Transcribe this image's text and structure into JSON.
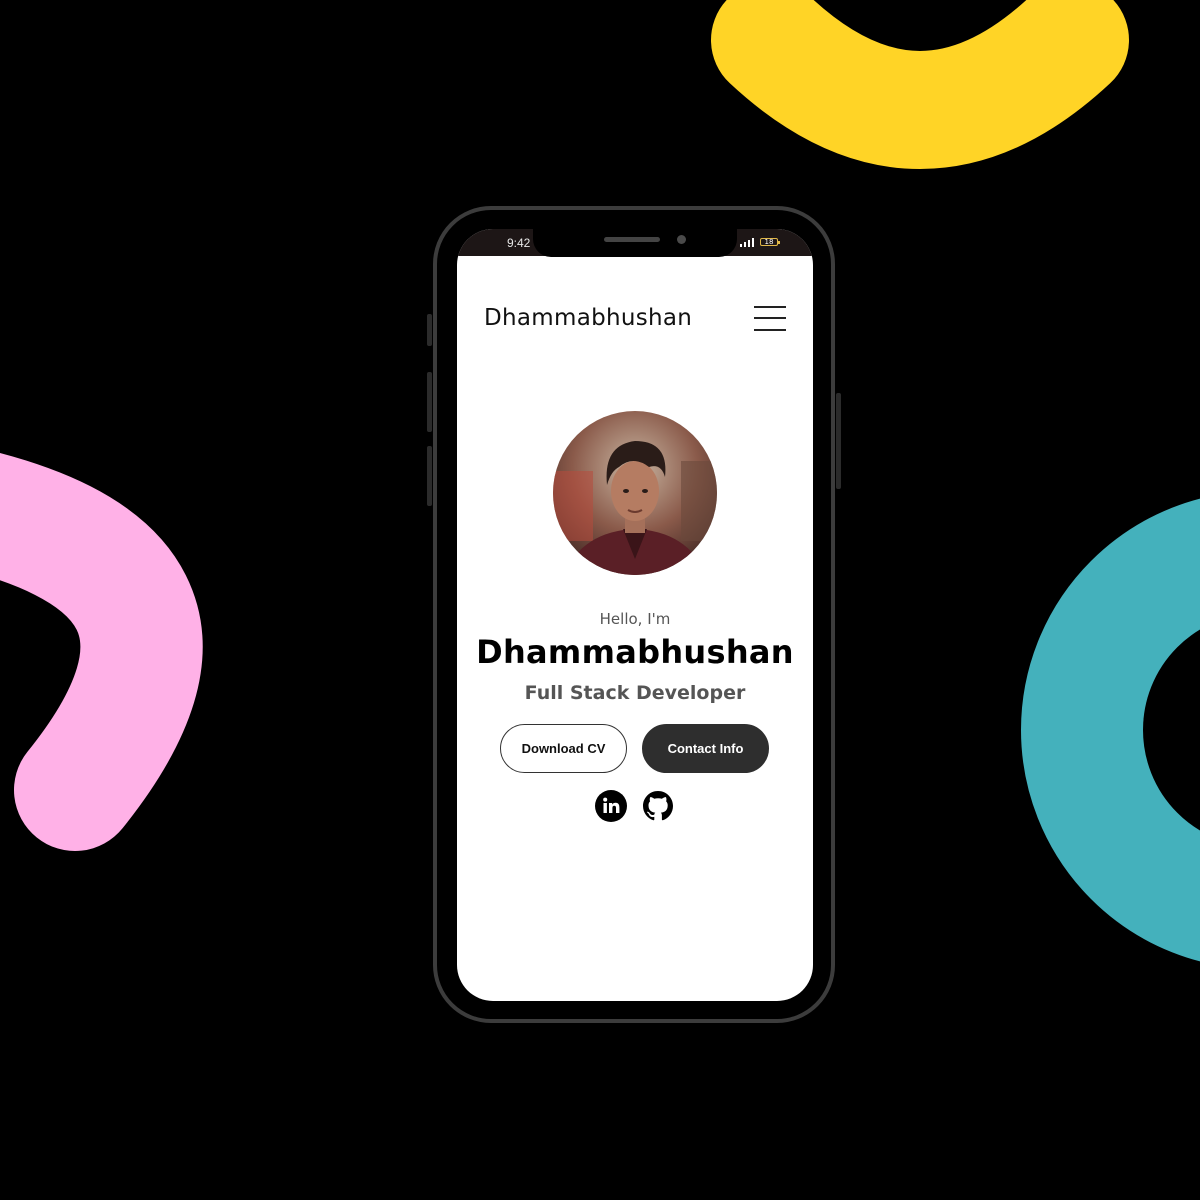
{
  "statusbar": {
    "time": "9:42",
    "battery": "18"
  },
  "header": {
    "brand": "Dhammabhushan"
  },
  "hero": {
    "greeting": "Hello, I'm",
    "name": "Dhammabhushan",
    "role": "Full Stack Developer"
  },
  "actions": {
    "download_cv": "Download CV",
    "contact_info": "Contact Info"
  },
  "social": {
    "icons": [
      "linkedin-icon",
      "github-icon"
    ]
  },
  "colors": {
    "background": "#000000",
    "yellow_shape": "#FFD426",
    "pink_shape": "#FFB1E7",
    "teal_shape": "#44B1BC",
    "dark_button": "#2E2E2E"
  }
}
